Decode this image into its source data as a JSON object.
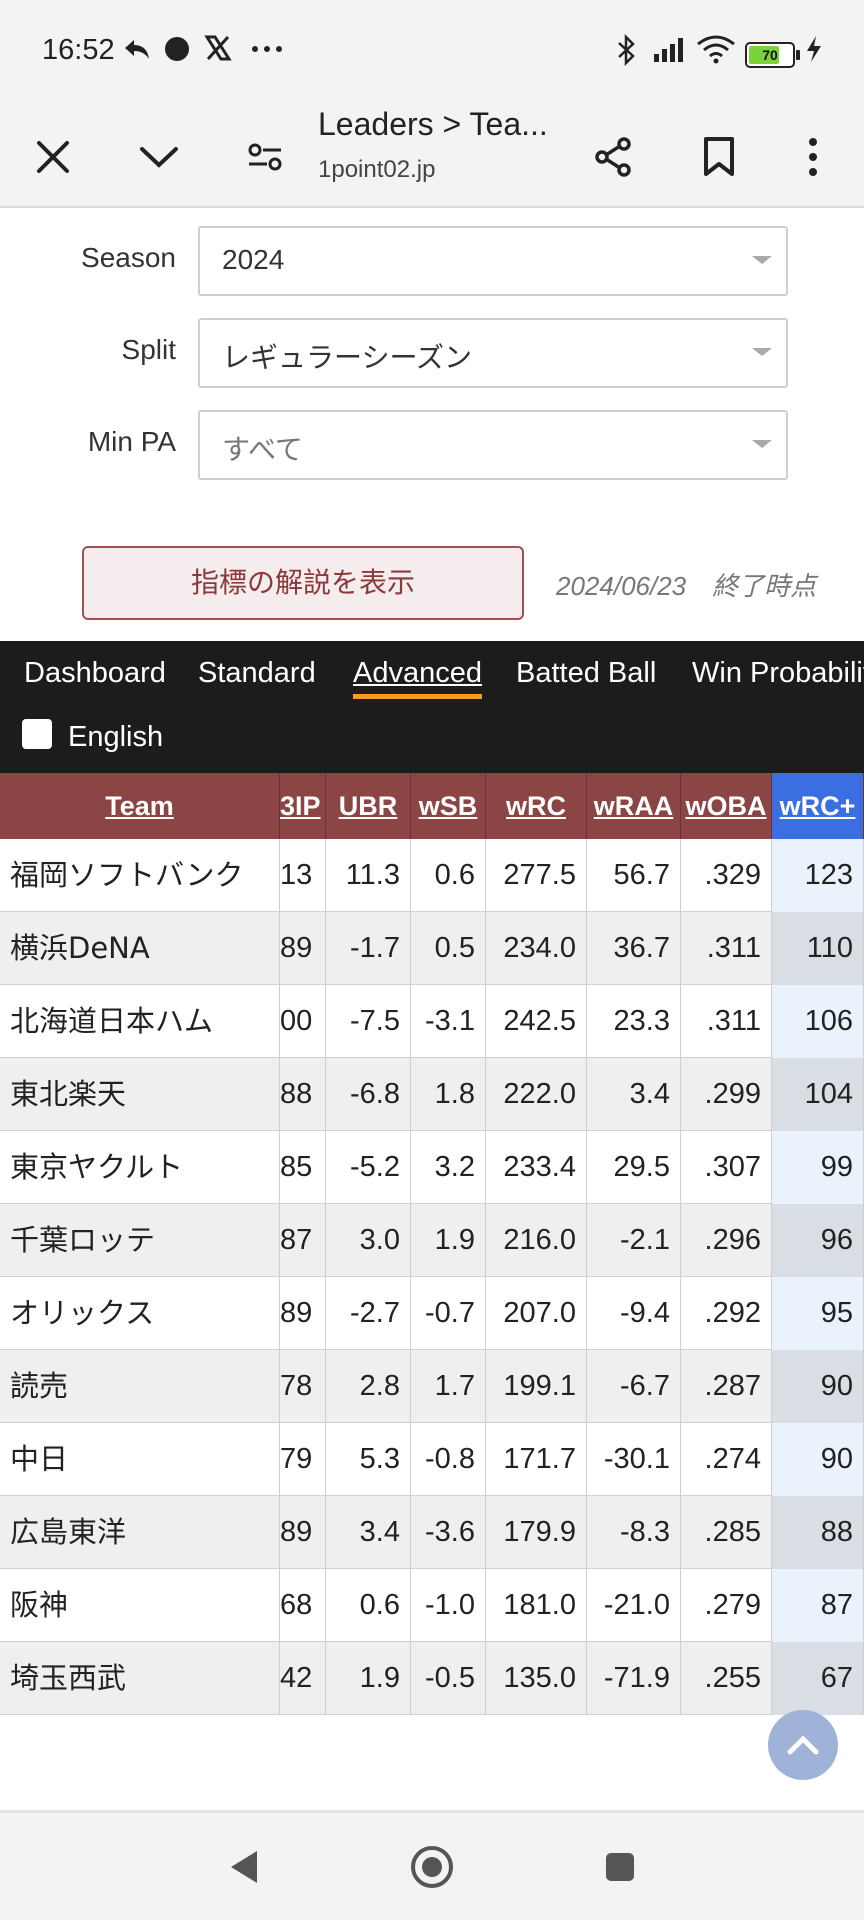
{
  "status_bar": {
    "time": "16:52",
    "battery_level": "70",
    "left_icons": [
      "reply-arrow-icon",
      "dot-icon",
      "x-logo-icon",
      "more-dots-icon"
    ],
    "right_icons": [
      "bluetooth-icon",
      "signal-icon",
      "wifi-icon",
      "battery-icon",
      "charging-icon"
    ]
  },
  "browser": {
    "title": "Leaders > Tea...",
    "url": "1point02.jp"
  },
  "filters": {
    "season": {
      "label": "Season",
      "value": "2024"
    },
    "split": {
      "label": "Split",
      "value": "レギュラーシーズン"
    },
    "min_pa": {
      "label": "Min PA",
      "value": "すべて"
    }
  },
  "explain_button": "指標の解説を表示",
  "as_of_date": "2024/06/23　終了時点",
  "tabs": [
    {
      "label": "Dashboard",
      "active": false
    },
    {
      "label": "Standard",
      "active": false
    },
    {
      "label": "Advanced",
      "active": true
    },
    {
      "label": "Batted Ball",
      "active": false
    },
    {
      "label": "Win Probabilit",
      "active": false
    }
  ],
  "english_toggle": {
    "label": "English",
    "checked": false
  },
  "table": {
    "headers": [
      "Team",
      "BIP",
      "UBR",
      "wSB",
      "wRC",
      "wRAA",
      "wOBA",
      "wRC+"
    ],
    "header_visible_fragment": "3IP",
    "sorted_column": "wRC+",
    "rows": [
      {
        "team": "福岡ソフトバンク",
        "bip": "13",
        "ubr": "11.3",
        "wsb": "0.6",
        "wrc": "277.5",
        "wraa": "56.7",
        "woba": ".329",
        "wrc_plus": "123"
      },
      {
        "team": "横浜DeNA",
        "bip": "89",
        "ubr": "-1.7",
        "wsb": "0.5",
        "wrc": "234.0",
        "wraa": "36.7",
        "woba": ".311",
        "wrc_plus": "110"
      },
      {
        "team": "北海道日本ハム",
        "bip": "00",
        "ubr": "-7.5",
        "wsb": "-3.1",
        "wrc": "242.5",
        "wraa": "23.3",
        "woba": ".311",
        "wrc_plus": "106"
      },
      {
        "team": "東北楽天",
        "bip": "88",
        "ubr": "-6.8",
        "wsb": "1.8",
        "wrc": "222.0",
        "wraa": "3.4",
        "woba": ".299",
        "wrc_plus": "104"
      },
      {
        "team": "東京ヤクルト",
        "bip": "85",
        "ubr": "-5.2",
        "wsb": "3.2",
        "wrc": "233.4",
        "wraa": "29.5",
        "woba": ".307",
        "wrc_plus": "99"
      },
      {
        "team": "千葉ロッテ",
        "bip": "87",
        "ubr": "3.0",
        "wsb": "1.9",
        "wrc": "216.0",
        "wraa": "-2.1",
        "woba": ".296",
        "wrc_plus": "96"
      },
      {
        "team": "オリックス",
        "bip": "89",
        "ubr": "-2.7",
        "wsb": "-0.7",
        "wrc": "207.0",
        "wraa": "-9.4",
        "woba": ".292",
        "wrc_plus": "95"
      },
      {
        "team": "読売",
        "bip": "78",
        "ubr": "2.8",
        "wsb": "1.7",
        "wrc": "199.1",
        "wraa": "-6.7",
        "woba": ".287",
        "wrc_plus": "90"
      },
      {
        "team": "中日",
        "bip": "79",
        "ubr": "5.3",
        "wsb": "-0.8",
        "wrc": "171.7",
        "wraa": "-30.1",
        "woba": ".274",
        "wrc_plus": "90"
      },
      {
        "team": "広島東洋",
        "bip": "89",
        "ubr": "3.4",
        "wsb": "-3.6",
        "wrc": "179.9",
        "wraa": "-8.3",
        "woba": ".285",
        "wrc_plus": "88"
      },
      {
        "team": "阪神",
        "bip": "68",
        "ubr": "0.6",
        "wsb": "-1.0",
        "wrc": "181.0",
        "wraa": "-21.0",
        "woba": ".279",
        "wrc_plus": "87"
      },
      {
        "team": "埼玉西武",
        "bip": "42",
        "ubr": "1.9",
        "wsb": "-0.5",
        "wrc": "135.0",
        "wraa": "-71.9",
        "woba": ".255",
        "wrc_plus": "67"
      }
    ]
  },
  "colors": {
    "header_bg": "#8c4545",
    "sorted_header_bg": "#3b6ee0",
    "tab_active_underline": "#f0a020",
    "tabbar_bg": "#1c1c1c"
  }
}
